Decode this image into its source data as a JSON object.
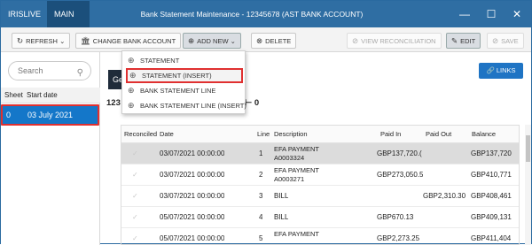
{
  "titlebar": {
    "tab_live": "IRISLIVE",
    "tab_main": "MAIN",
    "title": "Bank Statement Maintenance - 12345678 (AST BANK ACCOUNT)",
    "minimize": "—",
    "maximize": "☐",
    "close": "✕"
  },
  "toolbar": {
    "refresh": "REFRESH",
    "change_bank_account": "CHANGE BANK ACCOUNT",
    "add_new": "ADD NEW",
    "delete": "DELETE",
    "view_reconciliation": "VIEW RECONCILIATION",
    "edit": "EDIT",
    "save": "SAVE"
  },
  "dropdown": {
    "items": [
      "STATEMENT",
      "STATEMENT (INSERT)",
      "BANK STATEMENT LINE",
      "BANK STATEMENT LINE (INSERT)"
    ]
  },
  "left_panel": {
    "search_placeholder": "Search",
    "col_sheet": "Sheet",
    "col_start_date": "Start date",
    "row": {
      "sheet": "0",
      "start_date": "03 July 2021"
    }
  },
  "main": {
    "general_tab": "Ge",
    "links_button": "LINKS",
    "account_number_partial": "123",
    "arrow_zero": "⊢ 0"
  },
  "grid": {
    "headers": {
      "reconciled": "Reconciled",
      "date": "Date",
      "line": "Line",
      "description": "Description",
      "paid_in": "Paid In",
      "paid_out": "Paid Out",
      "balance": "Balance"
    },
    "rows": [
      {
        "date": "03/07/2021 00:00:00",
        "line": "1",
        "desc1": "EFA PAYMENT",
        "desc2": "A0003324",
        "paid_in": "GBP137,720.(",
        "paid_out": "",
        "balance": "GBP137,720"
      },
      {
        "date": "03/07/2021 00:00:00",
        "line": "2",
        "desc1": "EFA PAYMENT",
        "desc2": "A0003271",
        "paid_in": "GBP273,050.5",
        "paid_out": "",
        "balance": "GBP410,771"
      },
      {
        "date": "03/07/2021 00:00:00",
        "line": "3",
        "desc1": "BILL",
        "desc2": "",
        "paid_in": "",
        "paid_out": "GBP2,310.30",
        "balance": "GBP408,461"
      },
      {
        "date": "05/07/2021 00:00:00",
        "line": "4",
        "desc1": "BILL",
        "desc2": "",
        "paid_in": "GBP670.13",
        "paid_out": "",
        "balance": "GBP409,131"
      },
      {
        "date": "05/07/2021 00:00:00",
        "line": "5",
        "desc1": "EFA PAYMENT",
        "desc2": "",
        "paid_in": "GBP2,273.25",
        "paid_out": "",
        "balance": "GBP411,404"
      }
    ]
  }
}
